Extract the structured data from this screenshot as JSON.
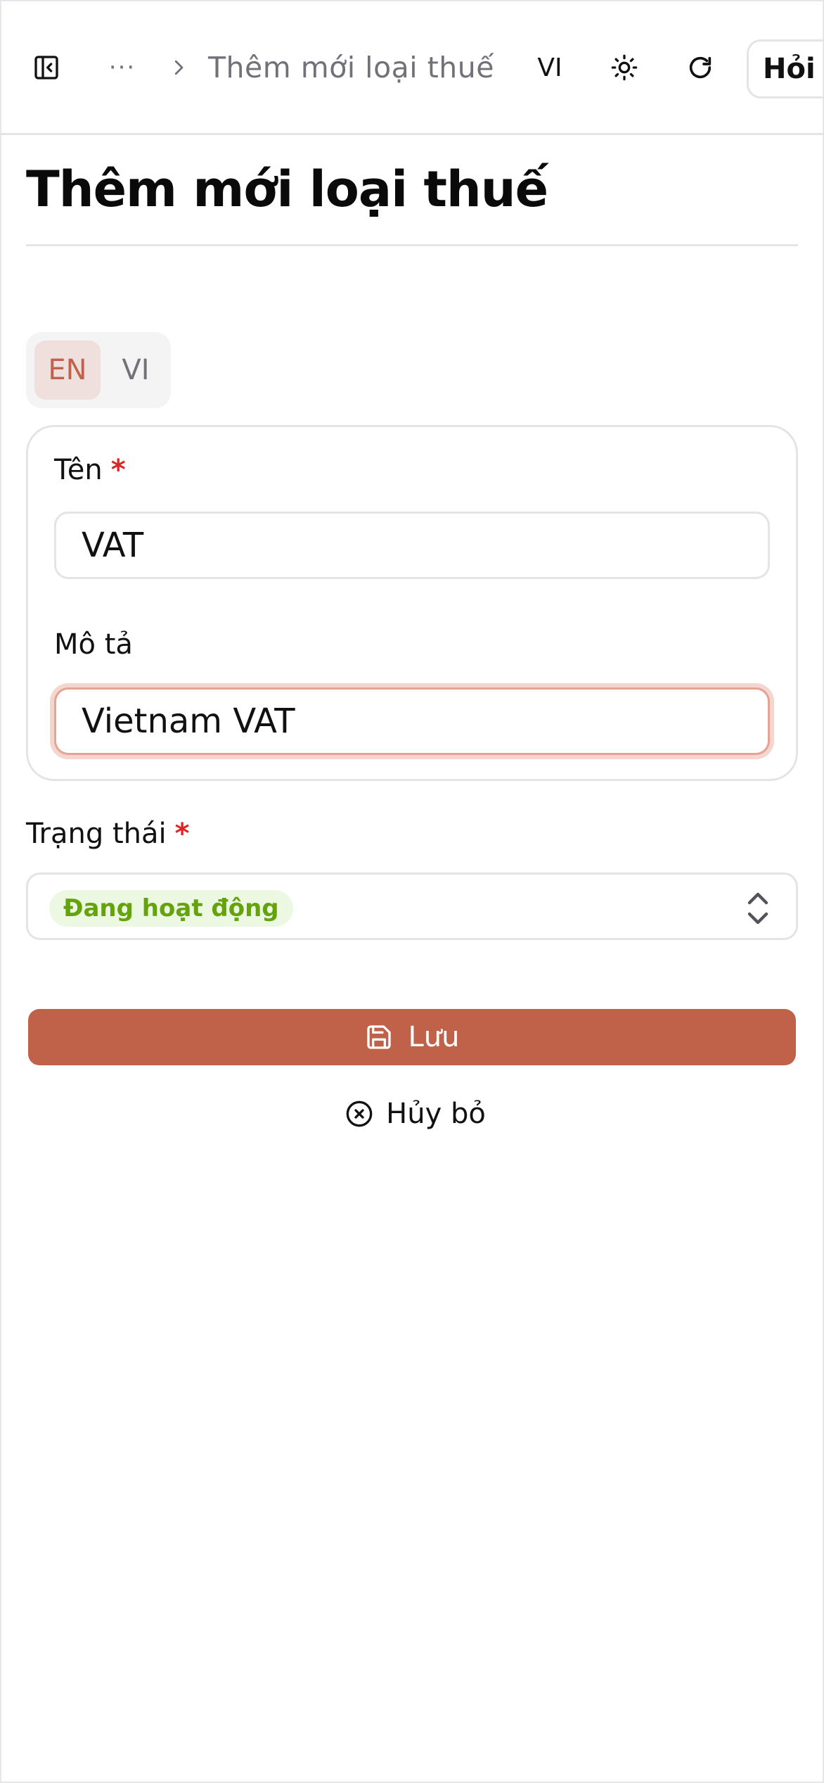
{
  "header": {
    "breadcrumb_current": "Thêm mới loại thuế",
    "ellipsis": "···",
    "language": "VI",
    "ask_button": "Hỏi AI"
  },
  "page": {
    "title": "Thêm mới loại thuế"
  },
  "lang_tabs": {
    "items": [
      "EN",
      "VI"
    ],
    "active": "EN"
  },
  "form": {
    "name_label": "Tên",
    "name_value": "VAT",
    "description_label": "Mô tả",
    "description_value": "Vietnam VAT",
    "status_label": "Trạng thái",
    "status_value": "Đang hoạt động",
    "required_mark": "*"
  },
  "actions": {
    "save_label": "Lưu",
    "cancel_label": "Hủy bỏ"
  },
  "colors": {
    "accent": "#c0614a",
    "accent_soft": "#efe0dd",
    "success_text": "#65a30d",
    "success_bg": "#ecf8e1",
    "required": "#dc2626"
  }
}
